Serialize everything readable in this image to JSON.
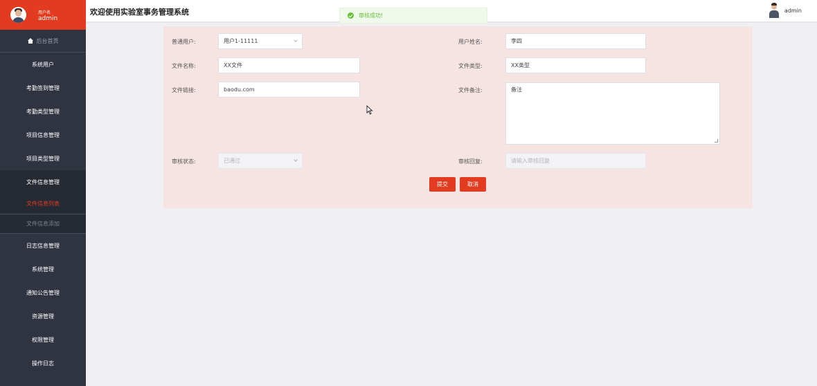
{
  "sidebar": {
    "user_role": "用户名",
    "user_name": "admin",
    "home_label": "后台首页",
    "items": [
      {
        "label": "系统用户"
      },
      {
        "label": "考勤签到管理"
      },
      {
        "label": "考勤类型管理"
      },
      {
        "label": "项目信息管理"
      },
      {
        "label": "项目类型管理"
      },
      {
        "label": "文件信息管理"
      }
    ],
    "submenu": [
      {
        "label": "文件信息列表",
        "active": true
      },
      {
        "label": "文件信息添加",
        "active": false
      }
    ],
    "items_after": [
      {
        "label": "日志信息管理"
      },
      {
        "label": "系统管理"
      },
      {
        "label": "通知公告管理"
      },
      {
        "label": "资源管理"
      },
      {
        "label": "权限管理"
      },
      {
        "label": "操作日志"
      }
    ]
  },
  "header": {
    "title": "欢迎使用实验室事务管理系统",
    "username": "admin"
  },
  "toast": {
    "message": "审核成功!"
  },
  "form": {
    "user_label": "普通用户:",
    "user_value": "用户1-11111",
    "realname_label": "用户姓名:",
    "realname_value": "李四",
    "filename_label": "文件名称:",
    "filename_value": "XX文件",
    "filetype_label": "文件类型:",
    "filetype_value": "XX类型",
    "filelink_label": "文件链接:",
    "filelink_value": "baodu.com",
    "remark_label": "文件备注:",
    "remark_value": "备注",
    "status_label": "审核状态:",
    "status_value": "已通过",
    "reply_label": "审核回复:",
    "reply_placeholder": "请输入审核回复",
    "submit_label": "提交",
    "cancel_label": "取消"
  },
  "colors": {
    "accent": "#e33b1f",
    "sidebar_bg": "#2f3440",
    "panel_bg": "#f6e4e3",
    "success": "#67c23a"
  }
}
